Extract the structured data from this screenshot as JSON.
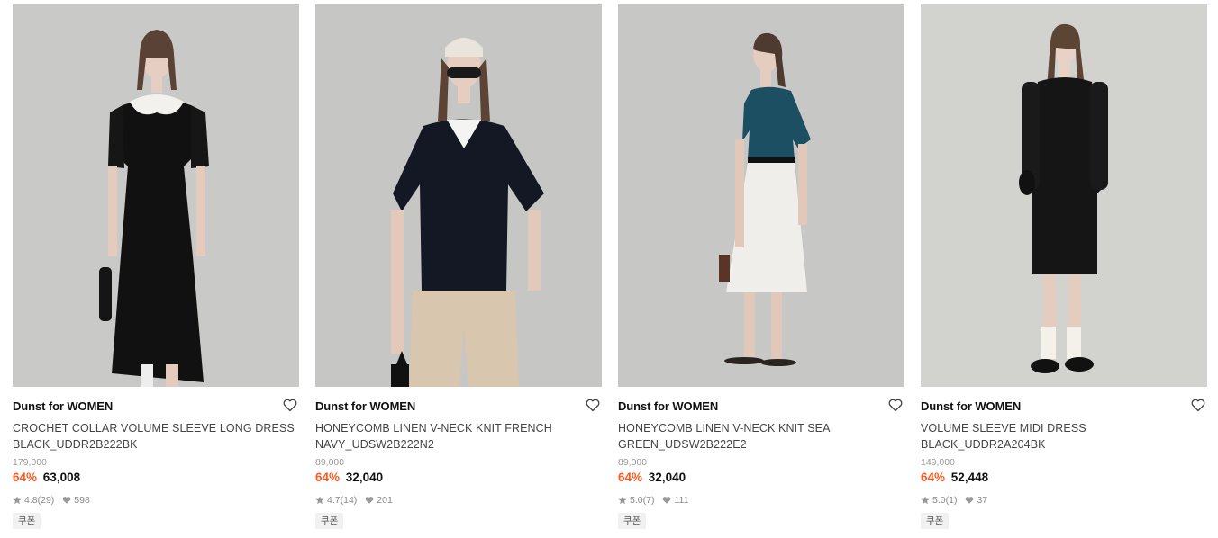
{
  "products": [
    {
      "brand": "Dunst for WOMEN",
      "name_line1": "CROCHET COLLAR VOLUME SLEEVE LONG DRESS",
      "name_line2": "BLACK_UDDR2B222BK",
      "original_price": "179,000",
      "discount": "64%",
      "price": "63,008",
      "rating": "4.8",
      "reviews": "(29)",
      "likes": "598",
      "coupon": "쿠폰",
      "bg_color": "#c9c9c7",
      "garment_color": "#111111"
    },
    {
      "brand": "Dunst for WOMEN",
      "name_line1": "HONEYCOMB LINEN V-NECK KNIT FRENCH",
      "name_line2": "NAVY_UDSW2B222N2",
      "original_price": "89,000",
      "discount": "64%",
      "price": "32,040",
      "rating": "4.7",
      "reviews": "(14)",
      "likes": "201",
      "coupon": "쿠폰",
      "bg_color": "#c6c6c4",
      "garment_color": "#141824"
    },
    {
      "brand": "Dunst for WOMEN",
      "name_line1": "HONEYCOMB LINEN V-NECK KNIT SEA",
      "name_line2": "GREEN_UDSW2B222E2",
      "original_price": "89,000",
      "discount": "64%",
      "price": "32,040",
      "rating": "5.0",
      "reviews": "(7)",
      "likes": "111",
      "coupon": "쿠폰",
      "bg_color": "#c7c7c5",
      "garment_color": "#1d4f63"
    },
    {
      "brand": "Dunst for WOMEN",
      "name_line1": "VOLUME SLEEVE MIDI DRESS BLACK_UDDR2A204BK",
      "name_line2": "",
      "original_price": "149,000",
      "discount": "64%",
      "price": "52,448",
      "rating": "5.0",
      "reviews": "(1)",
      "likes": "37",
      "coupon": "쿠폰",
      "bg_color": "#d2d2ce",
      "garment_color": "#151515"
    }
  ],
  "icons": {
    "like": "heart-outline-icon",
    "star": "star-icon",
    "likes_count": "heart-filled-icon"
  },
  "colors": {
    "discount": "#ff5a1f",
    "price": "#111111",
    "muted": "#888888"
  }
}
